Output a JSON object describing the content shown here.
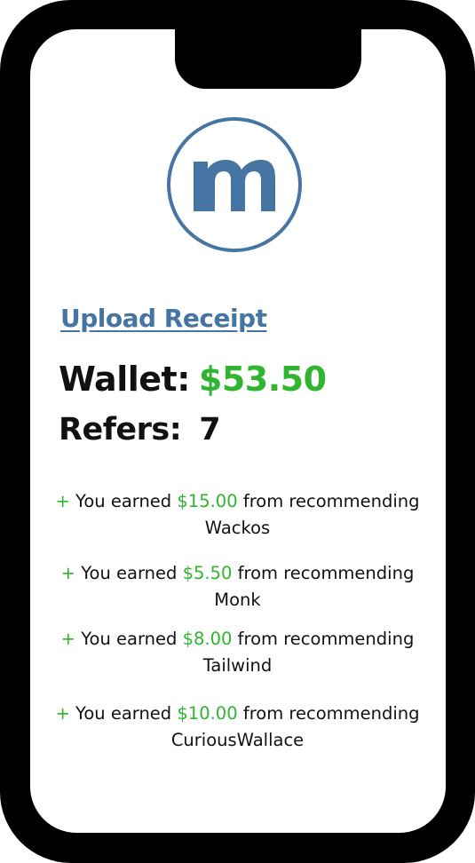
{
  "brand": {
    "logo_letter": "m",
    "accent_color": "#4674a3",
    "money_color": "#2fb52f"
  },
  "actions": {
    "upload_receipt": "Upload Receipt"
  },
  "wallet": {
    "label": "Wallet:",
    "amount": "$53.50"
  },
  "refers": {
    "label": "Refers:",
    "count": "7"
  },
  "activity": [
    {
      "prefix": "+",
      "text_before": "You earned",
      "amount": "$15.00",
      "text_after": "from recommending",
      "merchant": "Wackos"
    },
    {
      "prefix": "+",
      "text_before": "You earned",
      "amount": "$5.50",
      "text_after": "from recommending",
      "merchant": "Monk"
    },
    {
      "prefix": "+",
      "text_before": "You earned",
      "amount": "$8.00",
      "text_after": "from recommending",
      "merchant": "Tailwind"
    },
    {
      "prefix": "+",
      "text_before": "You earned",
      "amount": "$10.00",
      "text_after": "from recommending",
      "merchant": "CuriousWallace"
    }
  ]
}
